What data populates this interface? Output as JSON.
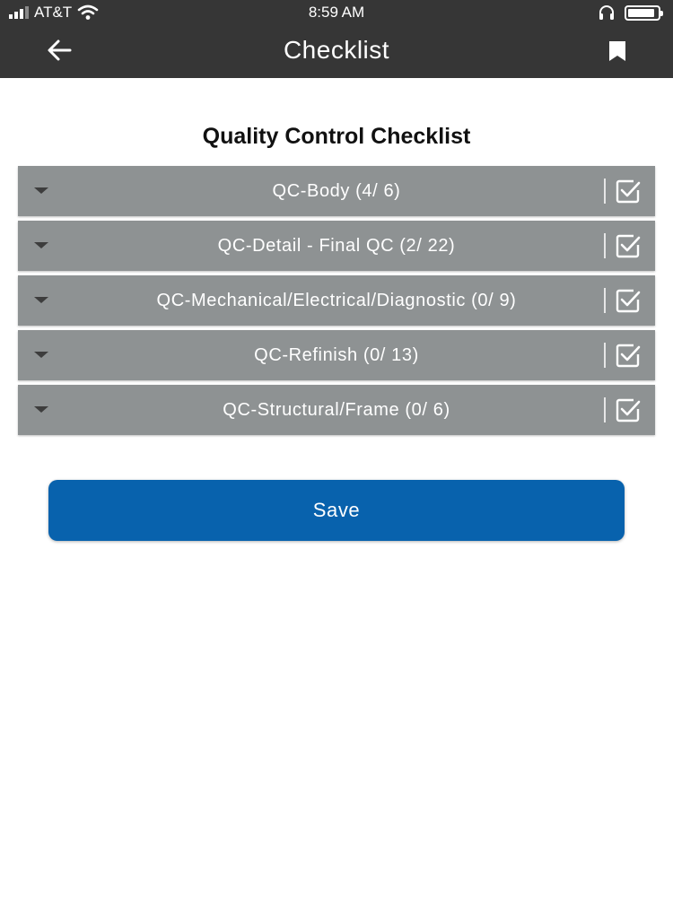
{
  "status_bar": {
    "carrier": "AT&T",
    "time": "8:59 AM"
  },
  "header": {
    "title": "Checklist",
    "back_icon": "arrow-left-icon",
    "bookmark_icon": "bookmark-icon"
  },
  "page": {
    "heading": "Quality Control Checklist"
  },
  "sections": [
    {
      "label": "QC-Body (4/ 6)"
    },
    {
      "label": "QC-Detail - Final QC (2/ 22)"
    },
    {
      "label": "QC-Mechanical/Electrical/Diagnostic (0/ 9)"
    },
    {
      "label": "QC-Refinish (0/ 13)"
    },
    {
      "label": "QC-Structural/Frame (0/ 6)"
    }
  ],
  "actions": {
    "save_label": "Save"
  },
  "colors": {
    "header_bg": "#363636",
    "section_bg": "#8e9293",
    "save_button_bg": "#0862ad"
  }
}
